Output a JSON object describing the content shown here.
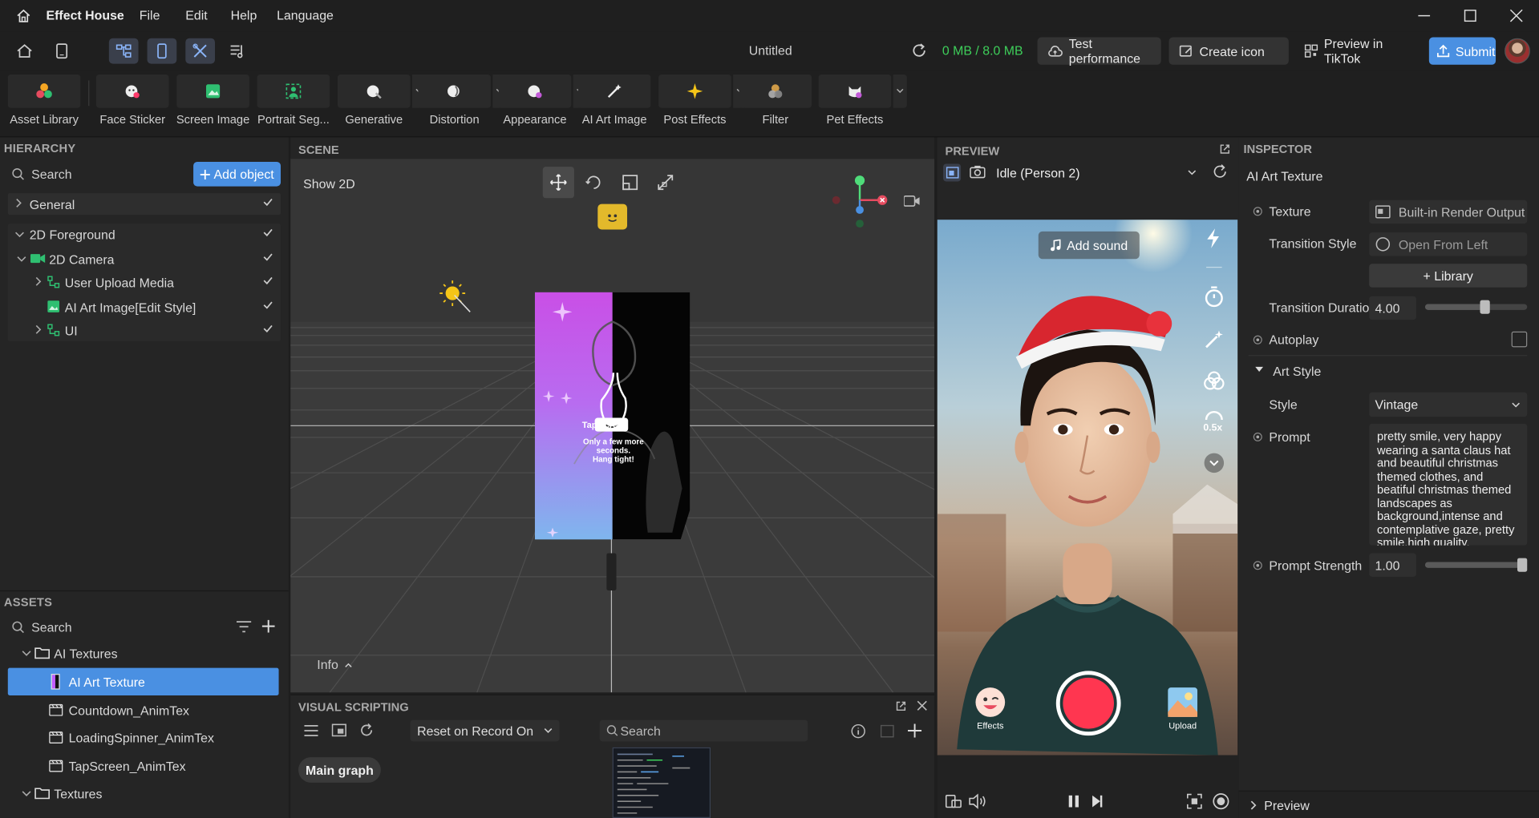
{
  "titlebar": {
    "app_name": "Effect House",
    "menu": [
      "File",
      "Edit",
      "Help",
      "Language"
    ]
  },
  "toolbar": {
    "project_title": "Untitled",
    "size_status": "0 MB / 8.0 MB",
    "test_performance": "Test performance",
    "create_icon": "Create icon",
    "preview_tiktok": "Preview in TikTok",
    "submit": "Submit"
  },
  "asset_bar": {
    "items": [
      {
        "label": "Asset Library",
        "icon": "asset-library-icon"
      },
      {
        "label": "Face Sticker",
        "icon": "face-sticker-icon"
      },
      {
        "label": "Screen Image",
        "icon": "screen-image-icon"
      },
      {
        "label": "Portrait Seg...",
        "icon": "portrait-seg-icon"
      },
      {
        "label": "Generative",
        "icon": "generative-icon"
      },
      {
        "label": "Distortion",
        "icon": "distortion-icon"
      },
      {
        "label": "Appearance",
        "icon": "appearance-icon"
      },
      {
        "label": "AI Art Image",
        "icon": "ai-art-image-icon"
      },
      {
        "label": "Post Effects",
        "icon": "post-effects-icon"
      },
      {
        "label": "Filter",
        "icon": "filter-icon"
      },
      {
        "label": "Pet Effects",
        "icon": "pet-effects-icon"
      }
    ]
  },
  "hierarchy": {
    "title": "HIERARCHY",
    "search_placeholder": "Search",
    "add_object": "Add object",
    "items": [
      "General",
      "2D Foreground",
      "2D Camera",
      "User Upload Media",
      "AI Art Image[Edit Style]",
      "UI"
    ]
  },
  "assets": {
    "title": "ASSETS",
    "search_placeholder": "Search",
    "items": [
      "AI Textures",
      "AI Art Texture",
      "Countdown_AnimTex",
      "LoadingSpinner_AnimTex",
      "TapScreen_AnimTex",
      "Textures"
    ]
  },
  "scene": {
    "title": "SCENE",
    "show_2d": "Show 2D",
    "info": "Info",
    "overlay_line1": "Tap screen",
    "overlay_line2": "Only a few more seconds.",
    "overlay_line3": "Hang tight!"
  },
  "visual_scripting": {
    "title": "VISUAL SCRIPTING",
    "reset_option": "Reset on Record On",
    "search_placeholder": "Search",
    "main_graph": "Main graph"
  },
  "preview": {
    "title": "PREVIEW",
    "person_select": "Idle (Person 2)",
    "add_sound": "Add sound",
    "speed": "0.5x",
    "effects": "Effects",
    "upload": "Upload"
  },
  "inspector": {
    "title": "INSPECTOR",
    "component": "AI Art Texture",
    "texture_label": "Texture",
    "texture_value": "Built-in Render Output",
    "transition_style_label": "Transition Style",
    "transition_style_value": "Open From Left",
    "library_button": "+ Library",
    "transition_duration_label": "Transition Duration",
    "transition_duration_value": "4.00",
    "transition_duration_slider": 0.6,
    "autoplay_label": "Autoplay",
    "autoplay_checked": false,
    "art_style_label": "Art Style",
    "style_label": "Style",
    "style_value": "Vintage",
    "prompt_label": "Prompt",
    "prompt_value": "pretty smile, very happy wearing a santa claus hat and beautiful  christmas themed clothes, and beatiful christmas themed landscapes as background,intense and contemplative gaze, pretty smile,high quality,",
    "prompt_strength_label": "Prompt Strength",
    "prompt_strength_value": "1.00",
    "prompt_strength_slider": 1.0,
    "preview_section": "Preview"
  },
  "colors": {
    "accent": "#4a90e2",
    "status_green": "#3ecf5a",
    "record_red": "#ff3650"
  }
}
